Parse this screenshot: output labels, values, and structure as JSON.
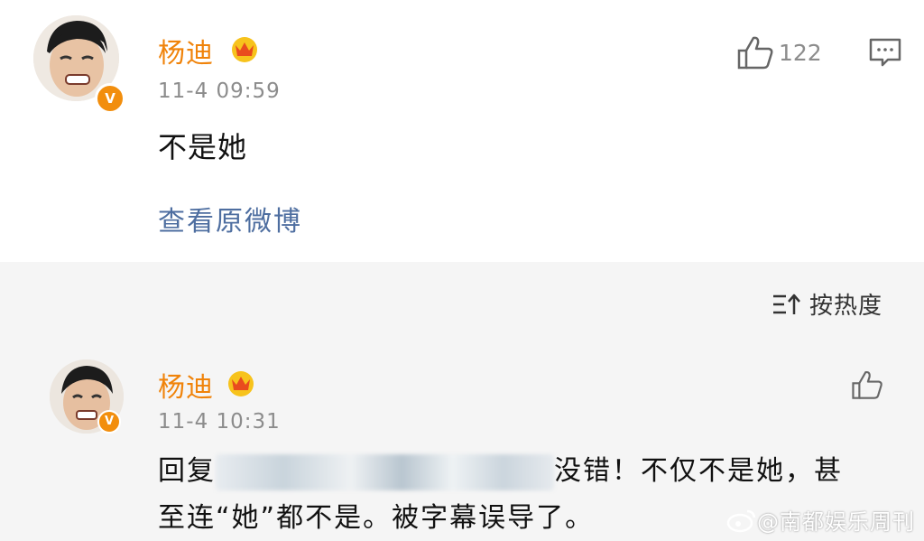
{
  "comment": {
    "author": "杨迪",
    "time": "11-4 09:59",
    "likes": "122",
    "text": "不是她",
    "view_original": "查看原微博"
  },
  "sort": {
    "label": "按热度"
  },
  "reply": {
    "author": "杨迪",
    "time": "11-4 10:31",
    "prefix": "回复",
    "line1_suffix": "没错！不仅不是她，甚",
    "line2": "至连“她”都不是。被字幕误导了。"
  },
  "watermark": {
    "text": "@南都娱乐周刊"
  },
  "colors": {
    "name_orange": "#f0830a",
    "link_blue": "#4e6ea0",
    "badge_orange": "#f28e0d",
    "time_gray": "#8c8c8c"
  },
  "icons": [
    "avatar",
    "verified-badge-icon",
    "crown-badge-icon",
    "thumbs-up-icon",
    "comment-icon",
    "sort-icon",
    "weibo-logo-icon"
  ]
}
